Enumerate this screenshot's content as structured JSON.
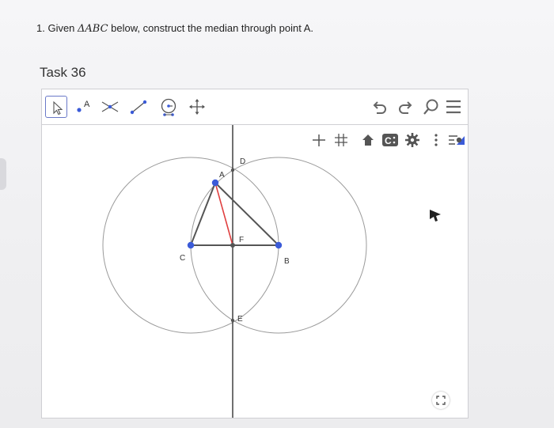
{
  "question": {
    "prefix": "1. Given ",
    "math": "ΔABC",
    "suffix": " below, construct the median through point A."
  },
  "task": {
    "title": "Task 36"
  },
  "toolbar": {
    "tools": [
      {
        "icon": "move-arrow-icon",
        "selected": true
      },
      {
        "icon": "point-icon",
        "label": "A"
      },
      {
        "icon": "intersect-icon"
      },
      {
        "icon": "segment-icon"
      },
      {
        "icon": "compass-icon"
      },
      {
        "icon": "move-view-icon"
      }
    ],
    "header_icons": [
      "undo-icon",
      "redo-icon",
      "search-icon",
      "menu-icon"
    ]
  },
  "graphics_style_bar": [
    "axes-icon",
    "grid-icon",
    "home-icon",
    "label-icon",
    "settings-icon",
    "more-icon",
    "style-bar-toggle-icon"
  ],
  "construction": {
    "points": {
      "A": {
        "label": "A"
      },
      "B": {
        "label": "B"
      },
      "C": {
        "label": "C"
      },
      "D": {
        "label": "D"
      },
      "E": {
        "label": "E"
      },
      "F": {
        "label": "F"
      }
    }
  },
  "colors": {
    "point": "#3b5bd8",
    "triangle_edge": "#555555",
    "median": "#e04040",
    "circle": "#9a9a9a",
    "bisector": "#333333",
    "selection": "#6a79c8"
  }
}
